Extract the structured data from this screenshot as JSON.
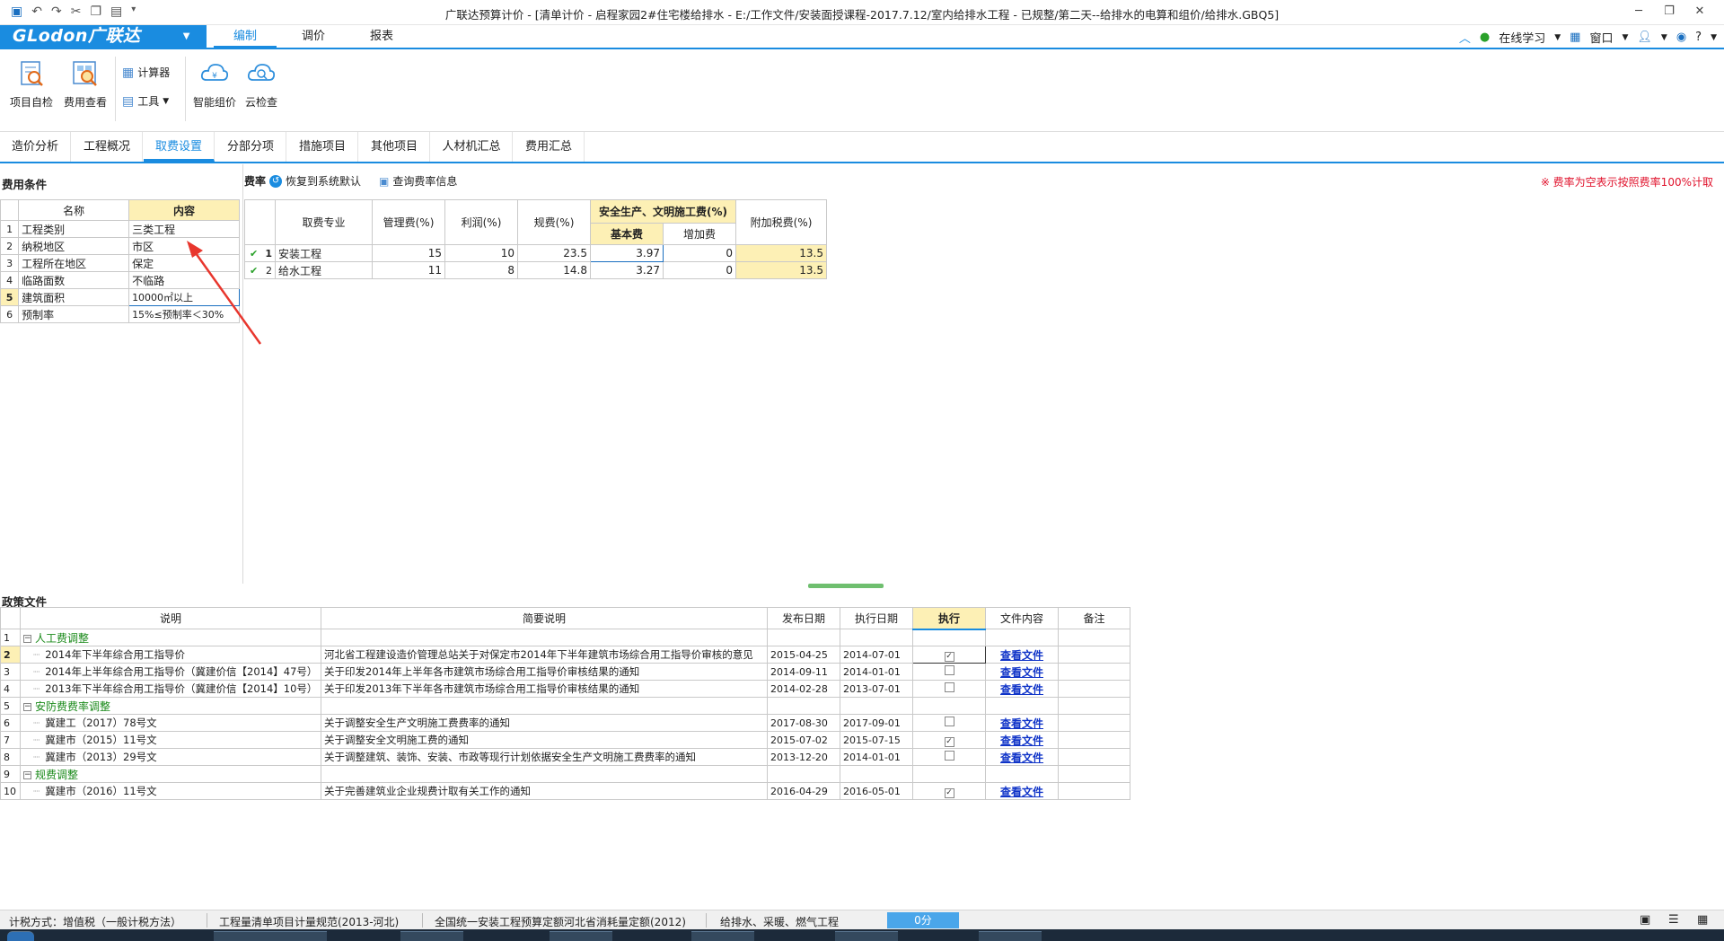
{
  "window": {
    "title": "广联达预算计价 - [清单计价 - 启程家园2#住宅楼给排水 - E:/工作文件/安装面授课程-2017.7.12/室内给排水工程 - 已规整/第二天--给排水的电算和组价/给排水.GBQ5]"
  },
  "menubar": {
    "logo": "GLodon广联达",
    "items": [
      "编制",
      "调价",
      "报表"
    ],
    "active": "编制",
    "online": "在线学习",
    "window_menu": "窗口"
  },
  "ribbon": {
    "project_check": "项目自检",
    "fee_view": "费用查看",
    "calculator": "计算器",
    "tools": "工具",
    "smart_price": "智能组价",
    "cloud_check": "云检查"
  },
  "tabs": [
    "造价分析",
    "工程概况",
    "取费设置",
    "分部分项",
    "措施项目",
    "其他项目",
    "人材机汇总",
    "费用汇总"
  ],
  "active_tab": "取费设置",
  "conditions": {
    "title": "费用条件",
    "headers": {
      "name": "名称",
      "content": "内容"
    },
    "rows": [
      {
        "idx": "1",
        "name": "工程类别",
        "value": "三类工程"
      },
      {
        "idx": "2",
        "name": "纳税地区",
        "value": "市区"
      },
      {
        "idx": "3",
        "name": "工程所在地区",
        "value": "保定"
      },
      {
        "idx": "4",
        "name": "临路面数",
        "value": "不临路"
      },
      {
        "idx": "5",
        "name": "建筑面积",
        "value": "10000㎡以上"
      },
      {
        "idx": "6",
        "name": "预制率",
        "value": "15%≤预制率＜30%"
      }
    ]
  },
  "rates": {
    "title": "费率",
    "restore": "恢复到系统默认",
    "query": "查询费率信息",
    "note": "※ 费率为空表示按照费率100%计取",
    "headers": {
      "specialty": "取费专业",
      "mgmt": "管理费(%)",
      "profit": "利润(%)",
      "regulation": "规费(%)",
      "safety": "安全生产、文明施工费(%)",
      "base": "基本费",
      "extra": "增加费",
      "tax": "附加税费(%)"
    },
    "rows": [
      {
        "idx": "1",
        "specialty": "安装工程",
        "mgmt": "15",
        "profit": "10",
        "regulation": "23.5",
        "base": "3.97",
        "extra": "0",
        "tax": "13.5"
      },
      {
        "idx": "2",
        "specialty": "给水工程",
        "mgmt": "11",
        "profit": "8",
        "regulation": "14.8",
        "base": "3.27",
        "extra": "0",
        "tax": "13.5"
      }
    ]
  },
  "policy": {
    "title": "政策文件",
    "headers": {
      "desc": "说明",
      "summary": "简要说明",
      "publish": "发布日期",
      "exec_date": "执行日期",
      "execute": "执行",
      "file": "文件内容",
      "remark": "备注"
    },
    "rows": [
      {
        "idx": "1",
        "group": true,
        "desc": "人工费调整"
      },
      {
        "idx": "2",
        "desc": "2014年下半年综合用工指导价",
        "summary": "河北省工程建设造价管理总站关于对保定市2014年下半年建筑市场综合用工指导价审核的意见",
        "publish": "2015-04-25",
        "exec_date": "2014-07-01",
        "checked": true,
        "file": "查看文件"
      },
      {
        "idx": "3",
        "desc": "2014年上半年综合用工指导价（冀建价信【2014】47号）",
        "summary": "关于印发2014年上半年各市建筑市场综合用工指导价审核结果的通知",
        "publish": "2014-09-11",
        "exec_date": "2014-01-01",
        "checked": false,
        "file": "查看文件"
      },
      {
        "idx": "4",
        "desc": "2013年下半年综合用工指导价（冀建价信【2014】10号）",
        "summary": "关于印发2013年下半年各市建筑市场综合用工指导价审核结果的通知",
        "publish": "2014-02-28",
        "exec_date": "2013-07-01",
        "checked": false,
        "file": "查看文件"
      },
      {
        "idx": "5",
        "group": true,
        "desc": "安防费费率调整"
      },
      {
        "idx": "6",
        "desc": "冀建工（2017）78号文",
        "summary": "关于调整安全生产文明施工费费率的通知",
        "publish": "2017-08-30",
        "exec_date": "2017-09-01",
        "checked": false,
        "file": "查看文件"
      },
      {
        "idx": "7",
        "desc": "冀建市（2015）11号文",
        "summary": "关于调整安全文明施工费的通知",
        "publish": "2015-07-02",
        "exec_date": "2015-07-15",
        "checked": true,
        "file": "查看文件"
      },
      {
        "idx": "8",
        "desc": "冀建市（2013）29号文",
        "summary": "关于调整建筑、装饰、安装、市政等现行计划依据安全生产文明施工费费率的通知",
        "publish": "2013-12-20",
        "exec_date": "2014-01-01",
        "checked": false,
        "file": "查看文件"
      },
      {
        "idx": "9",
        "group": true,
        "desc": "规费调整"
      },
      {
        "idx": "10",
        "desc": "冀建市（2016）11号文",
        "summary": "关于完善建筑业企业规费计取有关工作的通知",
        "publish": "2016-04-29",
        "exec_date": "2016-05-01",
        "checked": true,
        "file": "查看文件"
      }
    ]
  },
  "status": {
    "tax_method": "计税方式：增值税（一般计税方法）",
    "spec": "工程量清单项目计量规范(2013-河北)",
    "quota": "全国统一安装工程预算定额河北省消耗量定额(2012)",
    "category": "给排水、采暖、燃气工程",
    "score": "0分"
  },
  "colors": {
    "accent": "#1a8ce0",
    "highlight": "#fdf0b5",
    "group_text": "#1a8a1a",
    "link": "#1034c8",
    "arrow": "#e8362d"
  }
}
